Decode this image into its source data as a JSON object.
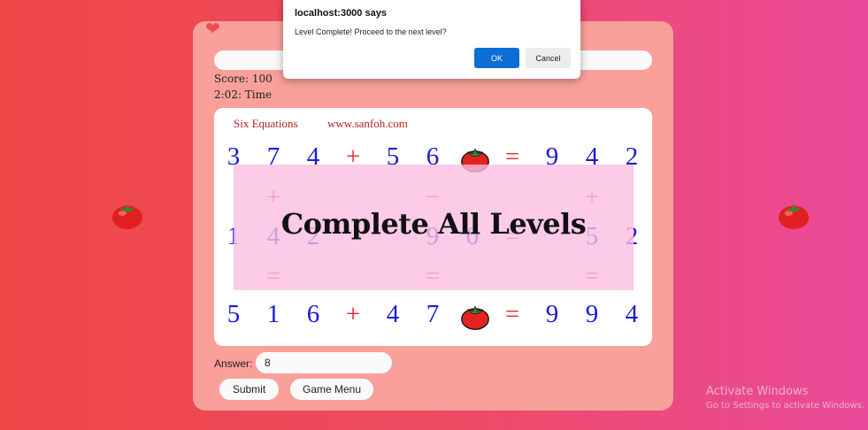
{
  "dialog": {
    "title": "localhost:3000 says",
    "message": "Level Complete! Proceed to the next level?",
    "ok_label": "OK",
    "cancel_label": "Cancel"
  },
  "icons": {
    "heart": "heart-icon",
    "tomato": "tomato-icon"
  },
  "stats": {
    "score": "Score: 100",
    "time": "2:02: Time"
  },
  "board": {
    "title_left": "Six Equations",
    "title_right": "www.sanfoh.com",
    "rows": [
      [
        "3",
        "7",
        "4",
        "+",
        "5",
        "6",
        "tomato",
        "=",
        "9",
        "4",
        "2"
      ],
      [
        "+",
        "",
        "",
        "",
        "−",
        "",
        "",
        "",
        "+"
      ],
      [
        "1",
        "4",
        "2",
        "",
        "9",
        "0",
        "=",
        "",
        "5",
        "2"
      ],
      [
        "=",
        "",
        "",
        "",
        "=",
        "",
        "",
        "",
        "="
      ],
      [
        "5",
        "1",
        "6",
        "+",
        "4",
        "7",
        "tomato",
        "=",
        "9",
        "9",
        "4"
      ]
    ],
    "overlay_text": "Complete All Levels"
  },
  "answer": {
    "label": "Answer:",
    "value": "8"
  },
  "buttons": {
    "submit": "Submit",
    "game_menu": "Game Menu"
  },
  "watermark": {
    "line1": "Activate Windows",
    "line2": "Go to Settings to activate Windows."
  },
  "colors": {
    "number": "#1a1ad6",
    "operator": "#ee2233",
    "panel": "#f9a09b",
    "overlay": "#fabee1"
  }
}
